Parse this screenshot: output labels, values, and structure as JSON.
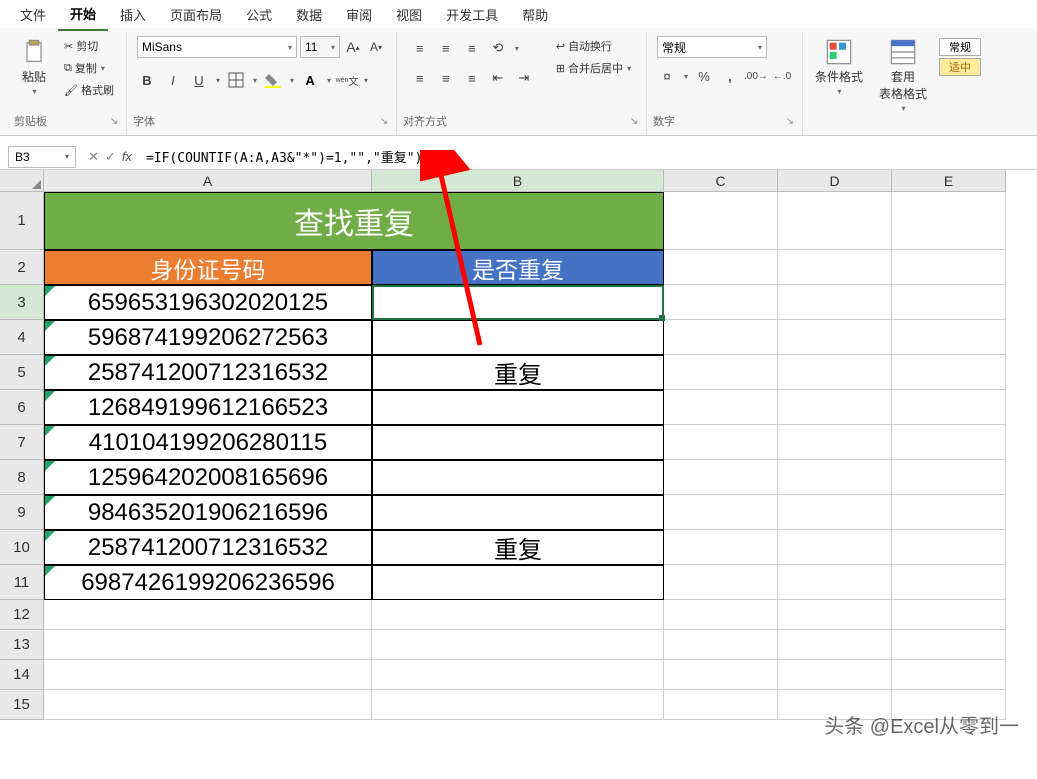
{
  "tabs": [
    "文件",
    "开始",
    "插入",
    "页面布局",
    "公式",
    "数据",
    "审阅",
    "视图",
    "开发工具",
    "帮助"
  ],
  "active_tab": 1,
  "ribbon": {
    "clipboard": {
      "label": "剪贴板",
      "paste": "粘贴",
      "cut": "剪切",
      "copy": "复制",
      "format_painter": "格式刷"
    },
    "font": {
      "label": "字体",
      "name": "MiSans",
      "size": "11",
      "bold": "B",
      "italic": "I",
      "underline": "U"
    },
    "align": {
      "label": "对齐方式",
      "wrap": "自动换行",
      "merge": "合并后居中"
    },
    "number": {
      "label": "数字",
      "format": "常规"
    },
    "styles": {
      "cond": "条件格式",
      "table": "套用\n表格格式",
      "normal": "常规",
      "ok": "适中"
    }
  },
  "formula_bar": {
    "ref": "B3",
    "formula": "=IF(COUNTIF(A:A,A3&\"*\")=1,\"\",\"重复\")"
  },
  "columns": [
    "A",
    "B",
    "C",
    "D",
    "E"
  ],
  "sheet": {
    "title": "查找重复",
    "header_a": "身份证号码",
    "header_b": "是否重复",
    "rows": [
      {
        "a": "659653196302020125",
        "b": ""
      },
      {
        "a": "596874199206272563",
        "b": ""
      },
      {
        "a": "258741200712316532",
        "b": "重复"
      },
      {
        "a": "126849199612166523",
        "b": ""
      },
      {
        "a": "410104199206280115",
        "b": ""
      },
      {
        "a": "125964202008165696",
        "b": ""
      },
      {
        "a": "984635201906216596",
        "b": ""
      },
      {
        "a": "258741200712316532",
        "b": "重复"
      },
      {
        "a": "698742619920623659",
        "b": ""
      }
    ]
  },
  "last_row_display": "6987426199206236596",
  "watermark": "头条 @Excel从零到一",
  "active_cell": "B3"
}
